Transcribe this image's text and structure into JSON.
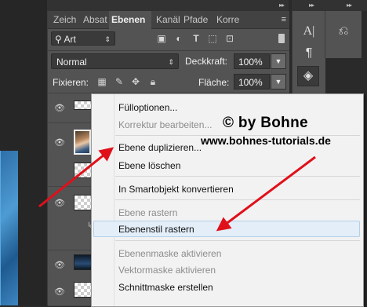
{
  "tabs": [
    "Zeich",
    "Absat",
    "Ebenen",
    "Kanäl",
    "Pfade",
    "Korre"
  ],
  "active_tab": "Ebenen",
  "filter": {
    "kind_label": "Art",
    "icons": [
      "image-icon",
      "adjustment-icon",
      "type-icon",
      "shape-icon",
      "smartobject-icon"
    ]
  },
  "blend": {
    "mode": "Normal",
    "opacity_label": "Deckkraft:",
    "opacity_value": "100%"
  },
  "lock": {
    "label": "Fixieren:",
    "fill_label": "Fläche:",
    "fill_value": "100%"
  },
  "context_menu": {
    "items": [
      {
        "label": "Fülloptionen...",
        "enabled": true
      },
      {
        "label": "Korrektur bearbeiten...",
        "enabled": false
      },
      {
        "label": "Ebene duplizieren...",
        "enabled": true
      },
      {
        "label": "Ebene löschen",
        "enabled": true
      },
      {
        "label": "In Smartobjekt konvertieren",
        "enabled": true
      },
      {
        "label": "Ebene rastern",
        "enabled": false
      },
      {
        "label": "Ebenenstil rastern",
        "enabled": true,
        "highlighted": true
      },
      {
        "label": "Ebenenmaske aktivieren",
        "enabled": false
      },
      {
        "label": "Vektormaske aktivieren",
        "enabled": false
      },
      {
        "label": "Schnittmaske erstellen",
        "enabled": true
      }
    ]
  },
  "watermark": {
    "line1": "© by Bohne",
    "line2": "www.bohnes-tutorials.de"
  },
  "colors": {
    "panel_bg": "#535353",
    "menu_bg": "#f2f2f2",
    "menu_highlight": "#e3eef9",
    "arrow": "#e0101a"
  }
}
